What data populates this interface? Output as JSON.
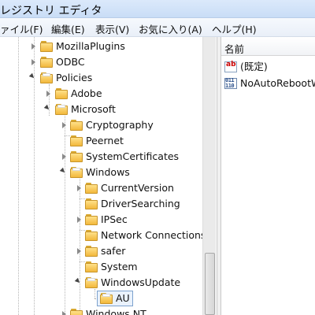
{
  "window": {
    "title": "レジストリ エディタ"
  },
  "menu": {
    "items": [
      {
        "label": "ァイル(F)"
      },
      {
        "label": "編集(E)"
      },
      {
        "label": "表示(V)"
      },
      {
        "label": "お気に入り(A)"
      },
      {
        "label": "ヘルプ(H)"
      }
    ]
  },
  "tree": {
    "nodes": [
      {
        "label": "MozillaPlugins",
        "expanded": false
      },
      {
        "label": "ODBC",
        "expanded": false
      },
      {
        "label": "Policies",
        "expanded": true
      },
      {
        "label": "Adobe",
        "expanded": false
      },
      {
        "label": "Microsoft",
        "expanded": true
      },
      {
        "label": "Cryptography",
        "expanded": false
      },
      {
        "label": "Peernet",
        "expanded": false
      },
      {
        "label": "SystemCertificates",
        "expanded": false
      },
      {
        "label": "Windows",
        "expanded": true
      },
      {
        "label": "CurrentVersion",
        "expanded": false
      },
      {
        "label": "DriverSearching",
        "expanded": false
      },
      {
        "label": "IPSec",
        "expanded": false
      },
      {
        "label": "Network Connections",
        "expanded": false
      },
      {
        "label": "safer",
        "expanded": false
      },
      {
        "label": "System",
        "expanded": false
      },
      {
        "label": "WindowsUpdate",
        "expanded": true
      },
      {
        "label": "AU",
        "selected": true
      },
      {
        "label": "Windows NT",
        "expanded": false
      }
    ]
  },
  "values_pane": {
    "column_header": "名前",
    "rows": [
      {
        "icon": "string-value-icon",
        "icon_text": "ab",
        "name": "(既定)"
      },
      {
        "icon": "dword-value-icon",
        "icon_text": "011\n110",
        "name": "NoAutoRebootWi"
      }
    ]
  },
  "colors": {
    "folder": "#f2b83b",
    "selection_border": "#7da2ce",
    "titlebar": "#c9ddf6"
  }
}
